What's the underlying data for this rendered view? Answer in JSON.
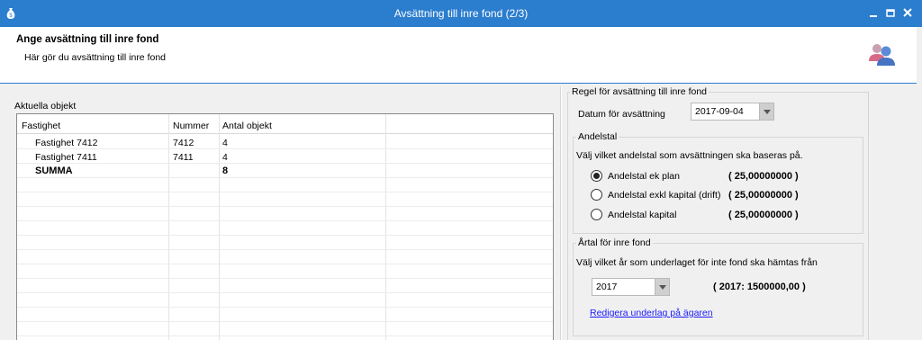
{
  "window": {
    "title": "Avsättning till inre fond (2/3)",
    "accent_color": "#2b7dce",
    "controls": [
      "minimize-icon",
      "maximize-icon",
      "close-icon"
    ]
  },
  "header": {
    "title": "Ange avsättning till inre fond",
    "subtitle": "Här gör du avsättning till inre fond",
    "icon": "users-icon"
  },
  "left": {
    "group_label": "Aktuella objekt",
    "columns": [
      "Fastighet",
      "Nummer",
      "Antal objekt"
    ],
    "rows": [
      {
        "fastighet": "Fastighet 7412",
        "nummer": "7412",
        "antal": "4"
      },
      {
        "fastighet": "Fastighet 7411",
        "nummer": "7411",
        "antal": "4"
      }
    ],
    "sum": {
      "label": "SUMMA",
      "antal": "8"
    }
  },
  "right": {
    "rule_group_label": "Regel för avsättning till inre fond",
    "date_label": "Datum för avsättning",
    "date_value": "2017-09-04",
    "andelstal": {
      "group_label": "Andelstal",
      "instruction": "Välj vilket andelstal som avsättningen ska baseras på.",
      "options": [
        {
          "label": "Andelstal ek plan",
          "value": "( 25,00000000 )",
          "checked": true
        },
        {
          "label": "Andelstal exkl kapital (drift)",
          "value": "( 25,00000000 )",
          "checked": false
        },
        {
          "label": "Andelstal kapital",
          "value": "( 25,00000000 )",
          "checked": false
        }
      ]
    },
    "artal": {
      "group_label": "Årtal för inre fond",
      "instruction": "Välj vilket år som underlaget för inte fond ska hämtas från",
      "year_value": "2017",
      "year_summary": "( 2017: 1500000,00 )",
      "link_label": "Redigera underlag på ägaren"
    }
  }
}
